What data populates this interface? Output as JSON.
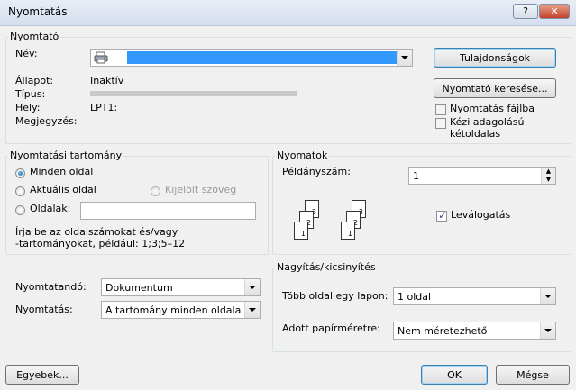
{
  "window": {
    "title": "Nyomtatás",
    "help_label": "?",
    "close_label": "✕"
  },
  "printer": {
    "group_label": "Nyomtató",
    "name_label": "Név:",
    "status_label": "Állapot:",
    "status_value": "Inaktív",
    "type_label": "Típus:",
    "where_label": "Hely:",
    "where_value": "LPT1:",
    "comment_label": "Megjegyzés:",
    "properties_button": "Tulajdonságok",
    "find_button": "Nyomtató keresése...",
    "print_to_file": "Nyomtatás fájlba",
    "manual_duplex": "Kézi adagolású kétoldalas"
  },
  "range": {
    "group_label": "Nyomtatási tartomány",
    "all": "Minden oldal",
    "current": "Aktuális oldal",
    "selection": "Kijelölt szöveg",
    "pages": "Oldalak:",
    "pages_value": "",
    "help_text": "Írja be az oldalszámokat és/vagy\n-tartományokat, például: 1;3;5–12"
  },
  "copies": {
    "group_label": "Nyomatok",
    "count_label": "Példányszám:",
    "count_value": "1",
    "collate": "Leválogatás"
  },
  "print_what": {
    "label": "Nyomtatandó:",
    "value": "Dokumentum"
  },
  "print": {
    "label": "Nyomtatás:",
    "value": "A tartomány minden oldala"
  },
  "zoom": {
    "group_label": "Nagyítás/kicsinyítés",
    "pages_per_sheet_label": "Több oldal egy lapon:",
    "pages_per_sheet_value": "1 oldal",
    "scale_label": "Adott papírméretre:",
    "scale_value": "Nem méretezhető"
  },
  "footer": {
    "options": "Egyebek...",
    "ok": "OK",
    "cancel": "Mégse"
  }
}
